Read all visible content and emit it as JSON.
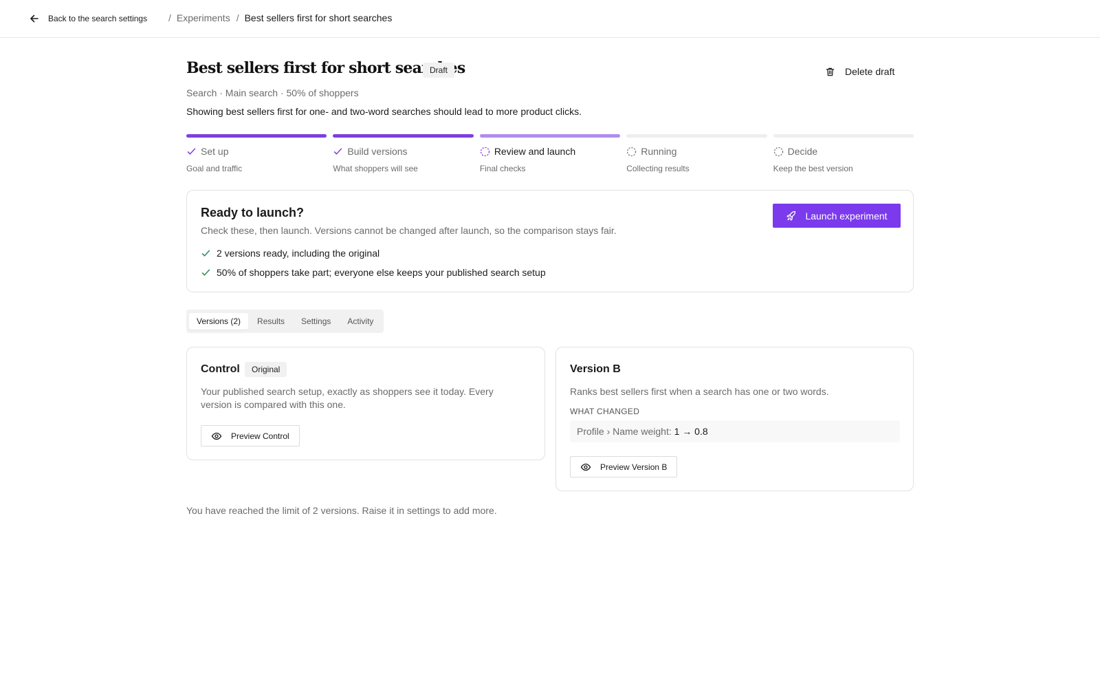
{
  "nav": {
    "back_label": "Back to the search settings",
    "breadcrumb": {
      "separator": "/",
      "parent": "Experiments",
      "current": "Best sellers first for short searches"
    }
  },
  "header": {
    "title": "Best sellers first for short searches",
    "status_badge": "Draft",
    "delete_label": "Delete draft",
    "meta": "Search · Main search · 50% of shoppers",
    "description": "Showing best sellers first for one- and two-word searches should lead to more product clicks."
  },
  "steps": [
    {
      "label": "Set up",
      "sub": "Goal and traffic",
      "state": "done"
    },
    {
      "label": "Build versions",
      "sub": "What shoppers will see",
      "state": "done"
    },
    {
      "label": "Review and launch",
      "sub": "Final checks",
      "state": "current"
    },
    {
      "label": "Running",
      "sub": "Collecting results",
      "state": "upcoming"
    },
    {
      "label": "Decide",
      "sub": "Keep the best version",
      "state": "upcoming"
    }
  ],
  "launch": {
    "title": "Ready to launch?",
    "subtitle": "Check these, then launch. Versions cannot be changed after launch, so the comparison stays fair.",
    "checks": [
      "2 versions ready, including the original",
      "50% of shoppers take part; everyone else keeps your published search setup"
    ],
    "button_label": "Launch experiment"
  },
  "tabs": [
    {
      "label": "Versions (2)",
      "active": true
    },
    {
      "label": "Results",
      "active": false
    },
    {
      "label": "Settings",
      "active": false
    },
    {
      "label": "Activity",
      "active": false
    }
  ],
  "versions": {
    "control": {
      "title": "Control",
      "badge": "Original",
      "description": "Your published search setup, exactly as shoppers see it today. Every version is compared with this one.",
      "preview_label": "Preview Control"
    },
    "version_b": {
      "title": "Version B",
      "description": "Ranks best sellers first when a search has one or two words.",
      "changed_label": "WHAT CHANGED",
      "change_key": "Profile › Name weight:",
      "change_value": "1 → 0.8",
      "preview_label": "Preview Version B"
    }
  },
  "limit_note": "You have reached the limit of 2 versions. Raise it in settings to add more.",
  "colors": {
    "accent": "#7c3aed",
    "step_done": "#7f3fe0",
    "step_current": "#b18cf0",
    "check_green": "#2e8a57"
  }
}
